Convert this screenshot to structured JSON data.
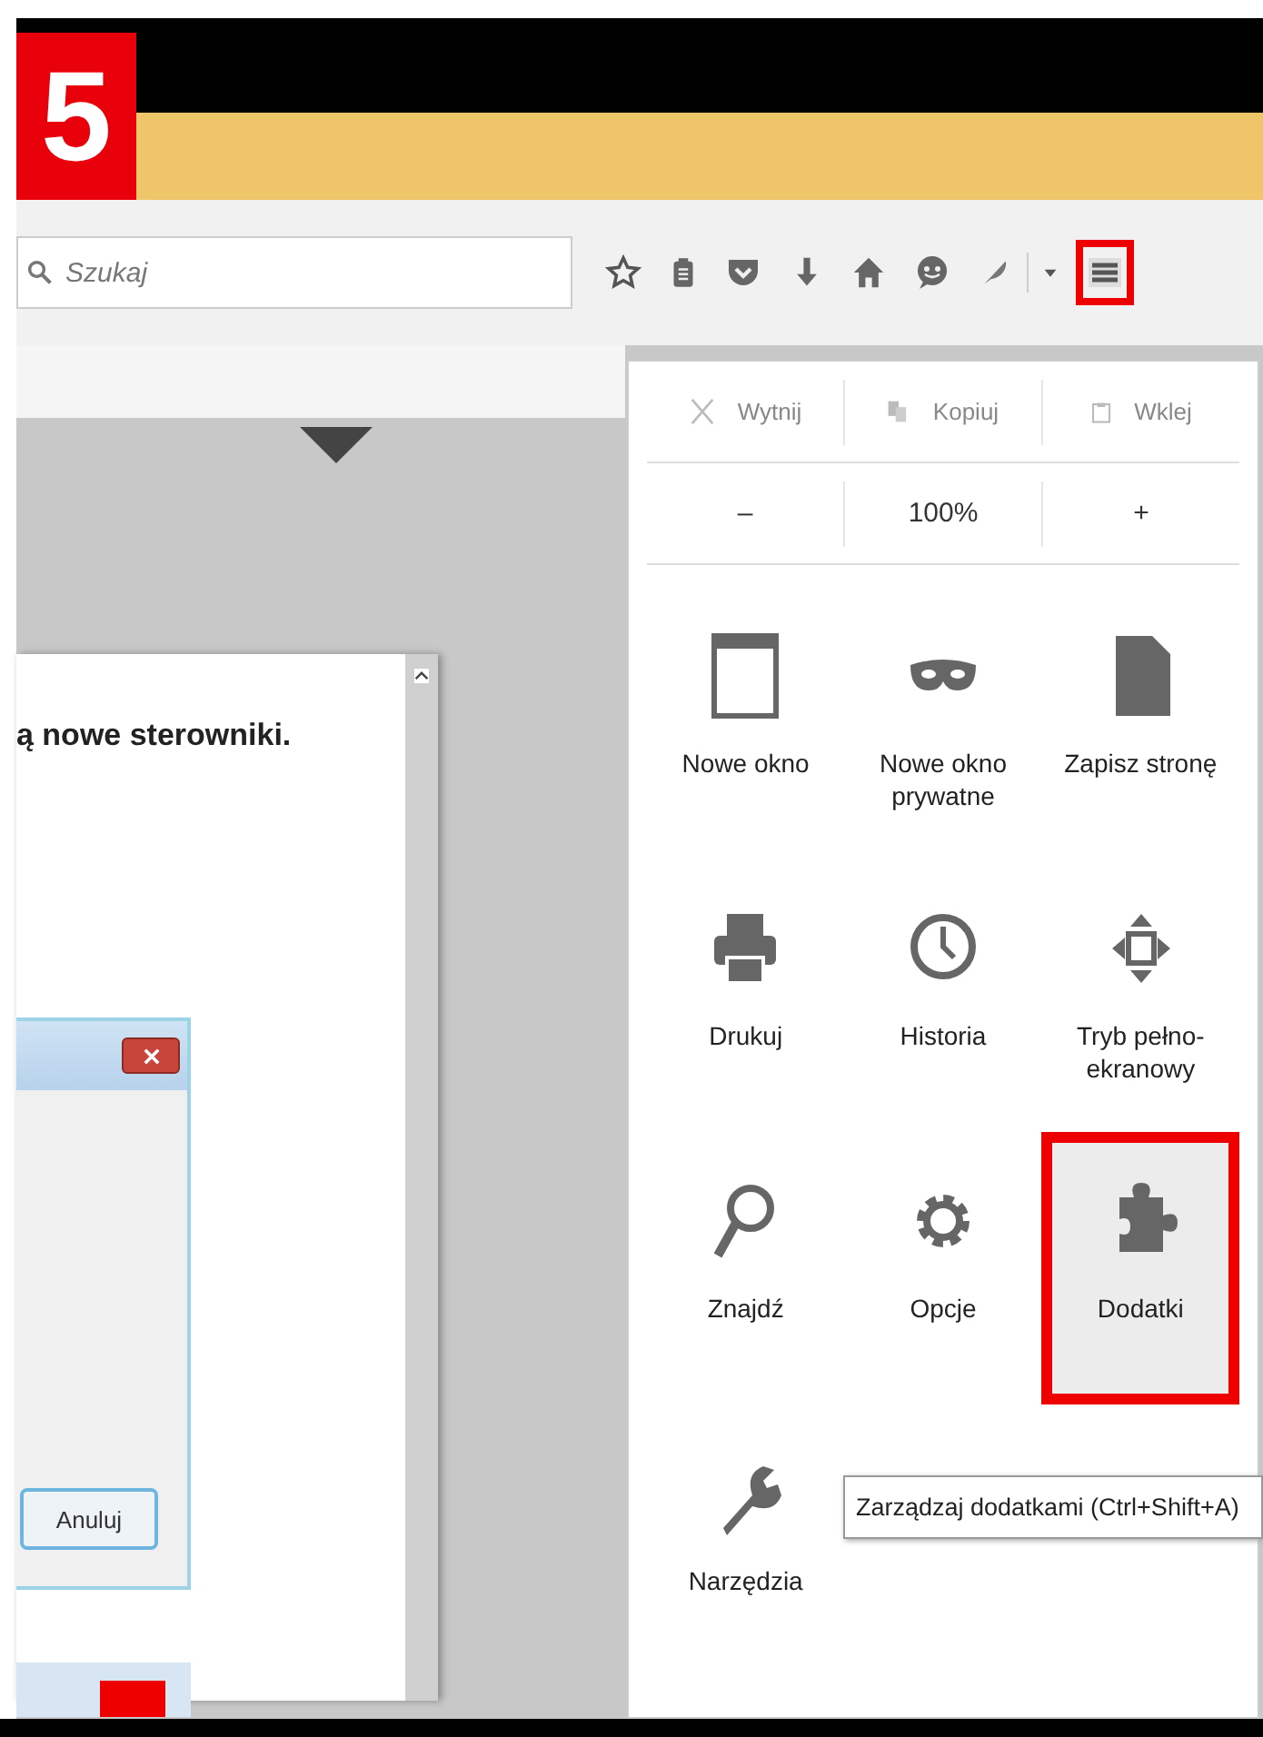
{
  "step_badge": "5",
  "toolbar": {
    "search": {
      "placeholder": "Szukaj"
    },
    "menu_button": {
      "highlighted": true
    }
  },
  "page": {
    "text": "ą nowe sterowniki.",
    "dialog": {
      "cancel_button": "Anuluj"
    }
  },
  "menu": {
    "edit_row": [
      {
        "label": "Wytnij",
        "disabled": true
      },
      {
        "label": "Kopiuj",
        "disabled": true
      },
      {
        "label": "Wklej",
        "disabled": true
      }
    ],
    "zoom": {
      "minus": "–",
      "value": "100%",
      "plus": "+"
    },
    "items": [
      {
        "label": "Nowe okno",
        "selected": false
      },
      {
        "label": "Nowe okno prywatne",
        "selected": false
      },
      {
        "label": "Zapisz stronę",
        "selected": false
      },
      {
        "label": "Drukuj",
        "selected": false
      },
      {
        "label": "Historia",
        "selected": false
      },
      {
        "label": "Tryb pełno-ekranowy",
        "selected": false
      },
      {
        "label": "Znajdź",
        "selected": false
      },
      {
        "label": "Opcje",
        "selected": false
      },
      {
        "label": "Dodatki",
        "selected": true
      },
      {
        "label": "Narzędzia",
        "selected": false
      }
    ],
    "tooltip": "Zarządzaj dodatkami (Ctrl+Shift+A)"
  }
}
